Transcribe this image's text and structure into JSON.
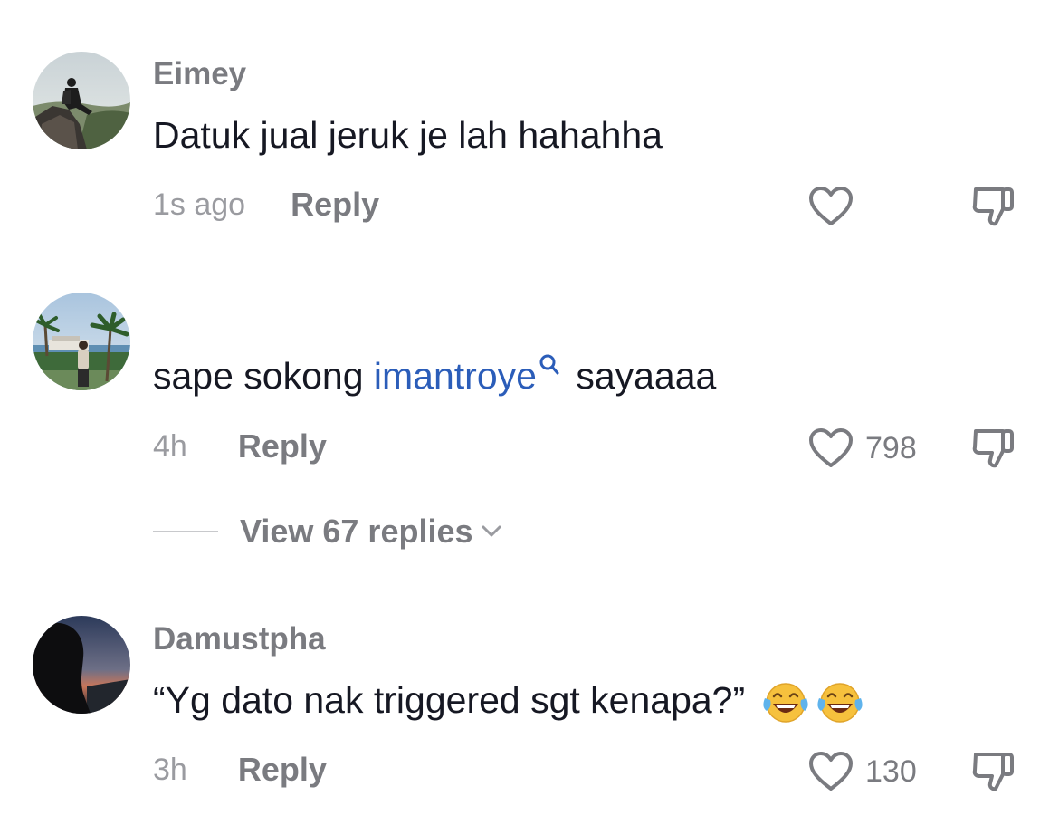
{
  "comments": [
    {
      "username": "Eimey",
      "text": "Datuk jual jeruk je lah hahahha",
      "timestamp": "1s ago",
      "reply_label": "Reply",
      "like_count": ""
    },
    {
      "username": "",
      "text_before": "sape sokong ",
      "mention": "imantroye",
      "text_after": " sayaaaa",
      "timestamp": "4h",
      "reply_label": "Reply",
      "like_count": "798",
      "view_replies_label": "View 67 replies"
    },
    {
      "username": "Damustpha",
      "text": "“Yg dato nak triggered sgt kenapa?”",
      "timestamp": "3h",
      "reply_label": "Reply",
      "like_count": "130",
      "emoji": [
        "face-with-tears-of-joy",
        "face-with-tears-of-joy"
      ]
    }
  ],
  "icons": {
    "like": "heart-outline-icon",
    "dislike": "thumbs-down-outline-icon",
    "mention_search": "magnifier-icon",
    "expand": "chevron-down-icon"
  },
  "colors": {
    "mention": "#2b5db9",
    "text": "#161823",
    "secondary": "#7a7b80",
    "muted": "#9a9ba0"
  }
}
